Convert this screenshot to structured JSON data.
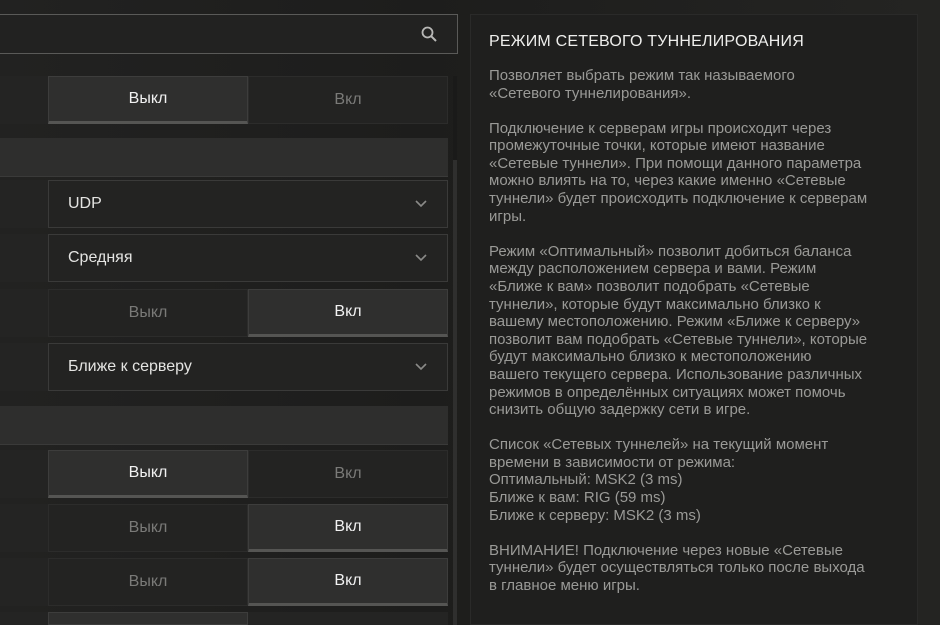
{
  "search": {
    "placeholder": ""
  },
  "settings": {
    "row1": {
      "off": "Выкл",
      "on": "Вкл"
    },
    "protocol": {
      "value": "UDP"
    },
    "quality": {
      "value": "Средняя"
    },
    "row4": {
      "off": "Выкл",
      "on": "Вкл"
    },
    "tunnel_mode": {
      "value": "Ближе к серверу"
    },
    "row6": {
      "off": "Выкл",
      "on": "Вкл"
    },
    "row7": {
      "off": "Выкл",
      "on": "Вкл"
    },
    "row8": {
      "off": "Выкл",
      "on": "Вкл"
    }
  },
  "info": {
    "title": "РЕЖИМ СЕТЕВОГО ТУННЕЛИРОВАНИЯ",
    "p1": "Позволяет выбрать режим так называемого\n«Сетевого туннелирования».",
    "p2": "Подключение к серверам игры происходит через\nпромежуточные точки, которые имеют название\n«Сетевые туннели». При помощи данного параметра\nможно влиять на то, через какие именно «Сетевые\nтуннели» будет происходить подключение к серверам\nигры.",
    "p3": "Режим «Оптимальный» позволит добиться баланса\nмежду расположением сервера и вами. Режим\n«Ближе к вам» позволит подобрать «Сетевые\nтуннели», которые будут максимально близко к\nвашему местоположению. Режим «Ближе к серверу»\nпозволит вам подобрать «Сетевые туннели», которые\nбудут максимально близко к местоположению\nвашего текущего сервера. Использование различных\nрежимов в определённых ситуациях может помочь\nснизить общую задержку сети в игре.",
    "p4": "Список «Сетевых туннелей» на текущий момент\nвремени в зависимости от режима:\nОптимальный: MSK2 (3 ms)\nБлиже к вам: RIG (59 ms)\nБлиже к серверу: MSK2 (3 ms)",
    "p5": "ВНИМАНИЕ! Подключение через новые «Сетевые\nтуннели» будет осуществляться только после выхода\nв главное меню игры."
  },
  "colors": {
    "active_text": "#f2f2f2",
    "inactive_text": "#7a7a78",
    "panel_bg": "#1f1f1e"
  }
}
